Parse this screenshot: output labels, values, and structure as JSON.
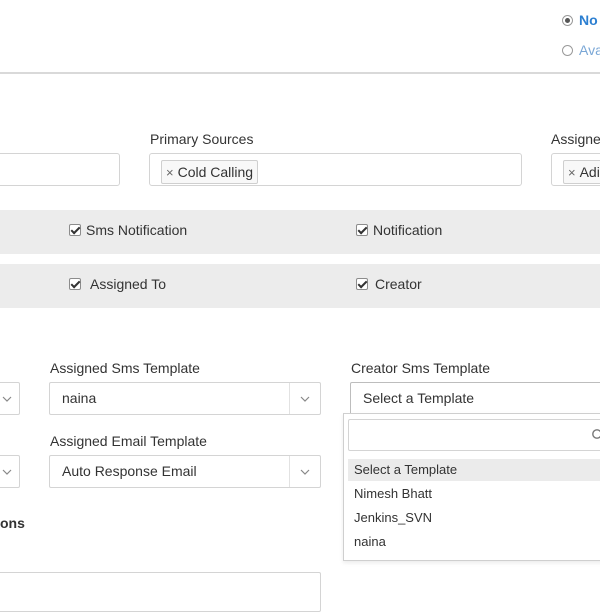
{
  "radios": [
    {
      "label": "No",
      "checked": true
    },
    {
      "label": "Ava",
      "checked": false
    }
  ],
  "sources": {
    "primary_label": "Primary Sources",
    "primary_tag": "Cold Calling",
    "assigned_label": "Assigne",
    "assigned_tag": "Adi",
    "tag_remove_glyph": "×"
  },
  "notifications": {
    "row1": [
      "Sms Notification",
      "Notification"
    ],
    "row2": [
      "Assigned To",
      "Creator"
    ]
  },
  "templates": {
    "assigned_sms_label": "Assigned Sms Template",
    "assigned_sms_value": "naina",
    "creator_sms_label": "Creator Sms Template",
    "creator_sms_value": "Select a Template",
    "assigned_email_label": "Assigned Email Template",
    "assigned_email_value": "Auto Response Email"
  },
  "dropdown": {
    "options": [
      "Select a Template",
      "Nimesh Bhatt",
      "Jenkins_SVN",
      "naina"
    ],
    "highlighted": "Select a Template"
  },
  "section_fragment": "ons",
  "icons": {
    "search": "search-icon",
    "chevron": "chevron-down-icon",
    "checkbox": "checkbox-checked-icon"
  }
}
